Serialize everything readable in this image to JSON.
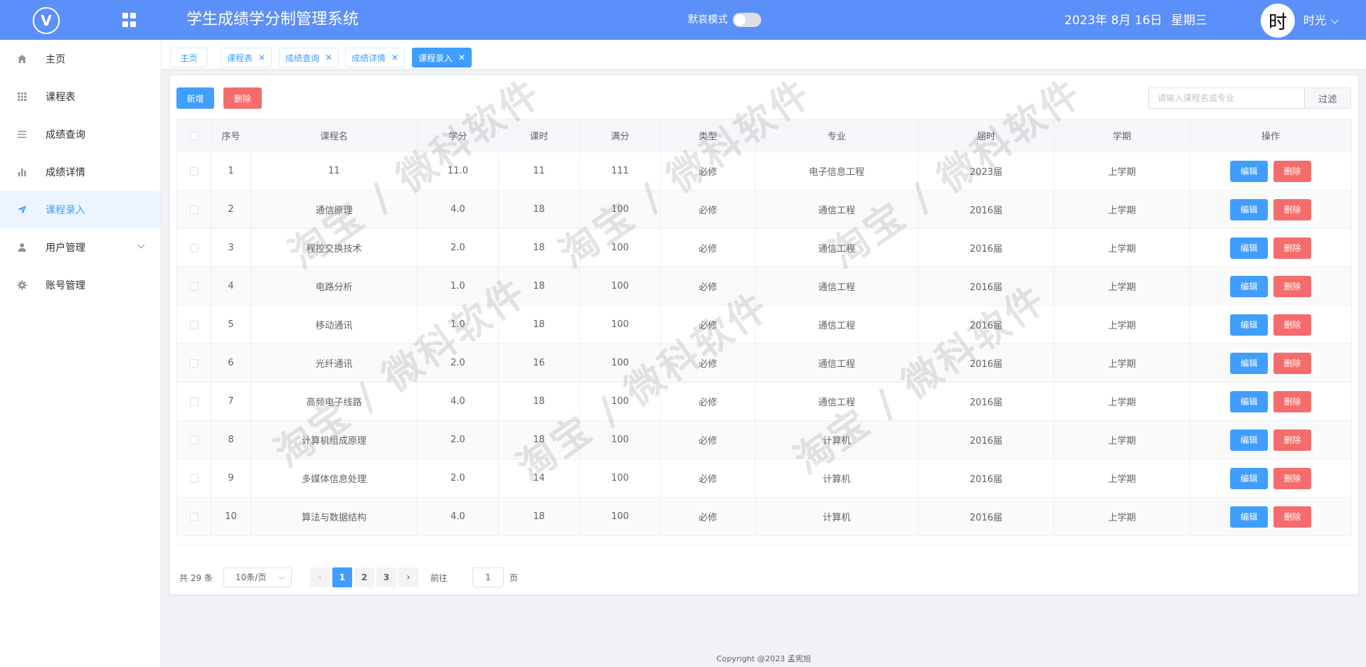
{
  "header": {
    "title": "学生成绩学分制管理系统",
    "mode_label": "默哀模式",
    "date": "2023年 8月 16日",
    "weekday": "星期三",
    "avatar_char": "时",
    "user_name": "时光",
    "accent_color": "#5b8ff9"
  },
  "sidebar": {
    "items": [
      {
        "label": "主页",
        "icon": "home-icon"
      },
      {
        "label": "课程表",
        "icon": "grid-icon"
      },
      {
        "label": "成绩查询",
        "icon": "list-icon"
      },
      {
        "label": "成绩详情",
        "icon": "bar-chart-icon"
      },
      {
        "label": "课程录入",
        "icon": "send-icon",
        "active": true
      },
      {
        "label": "用户管理",
        "icon": "user-icon",
        "expandable": true
      },
      {
        "label": "账号管理",
        "icon": "gear-icon"
      }
    ]
  },
  "tabs": [
    {
      "label": "主页",
      "closable": false
    },
    {
      "label": "课程表",
      "closable": true
    },
    {
      "label": "成绩查询",
      "closable": true
    },
    {
      "label": "成绩详情",
      "closable": true
    },
    {
      "label": "课程录入",
      "closable": true,
      "active": true
    }
  ],
  "toolbar": {
    "add_label": "新增",
    "delete_label": "删除",
    "search_placeholder": "请输入课程名或专业",
    "filter_label": "过滤"
  },
  "table": {
    "headers": [
      "序号",
      "课程名",
      "学分",
      "课时",
      "满分",
      "类型",
      "专业",
      "届时",
      "学期",
      "操作"
    ],
    "edit_label": "编辑",
    "delete_label": "删除",
    "rows": [
      {
        "no": "1",
        "name": "11",
        "credit": "11.0",
        "hours": "11",
        "full": "111",
        "type": "必修",
        "major": "电子信息工程",
        "year": "2023届",
        "term": "上学期"
      },
      {
        "no": "2",
        "name": "通信原理",
        "credit": "4.0",
        "hours": "18",
        "full": "100",
        "type": "必修",
        "major": "通信工程",
        "year": "2016届",
        "term": "上学期"
      },
      {
        "no": "3",
        "name": "程控交换技术",
        "credit": "2.0",
        "hours": "18",
        "full": "100",
        "type": "必修",
        "major": "通信工程",
        "year": "2016届",
        "term": "上学期"
      },
      {
        "no": "4",
        "name": "电路分析",
        "credit": "1.0",
        "hours": "18",
        "full": "100",
        "type": "必修",
        "major": "通信工程",
        "year": "2016届",
        "term": "上学期"
      },
      {
        "no": "5",
        "name": "移动通讯",
        "credit": "1.0",
        "hours": "18",
        "full": "100",
        "type": "必修",
        "major": "通信工程",
        "year": "2016届",
        "term": "上学期"
      },
      {
        "no": "6",
        "name": "光纤通讯",
        "credit": "2.0",
        "hours": "16",
        "full": "100",
        "type": "必修",
        "major": "通信工程",
        "year": "2016届",
        "term": "上学期"
      },
      {
        "no": "7",
        "name": "高频电子线路",
        "credit": "4.0",
        "hours": "18",
        "full": "100",
        "type": "必修",
        "major": "通信工程",
        "year": "2016届",
        "term": "上学期"
      },
      {
        "no": "8",
        "name": "计算机组成原理",
        "credit": "2.0",
        "hours": "18",
        "full": "100",
        "type": "必修",
        "major": "计算机",
        "year": "2016届",
        "term": "上学期"
      },
      {
        "no": "9",
        "name": "多媒体信息处理",
        "credit": "2.0",
        "hours": "14",
        "full": "100",
        "type": "必修",
        "major": "计算机",
        "year": "2016届",
        "term": "上学期"
      },
      {
        "no": "10",
        "name": "算法与数据结构",
        "credit": "4.0",
        "hours": "18",
        "full": "100",
        "type": "必修",
        "major": "计算机",
        "year": "2016届",
        "term": "上学期"
      }
    ]
  },
  "pagination": {
    "total_text": "共 29 条",
    "page_size": "10条/页",
    "pages": [
      "1",
      "2",
      "3"
    ],
    "current_page": "1",
    "goto_prefix": "前往",
    "goto_value": "1",
    "goto_suffix": "页"
  },
  "footer": {
    "copyright": "Copyright @2023 孟宪旭"
  },
  "watermark": {
    "text": "淘宝 / 微科软件"
  }
}
